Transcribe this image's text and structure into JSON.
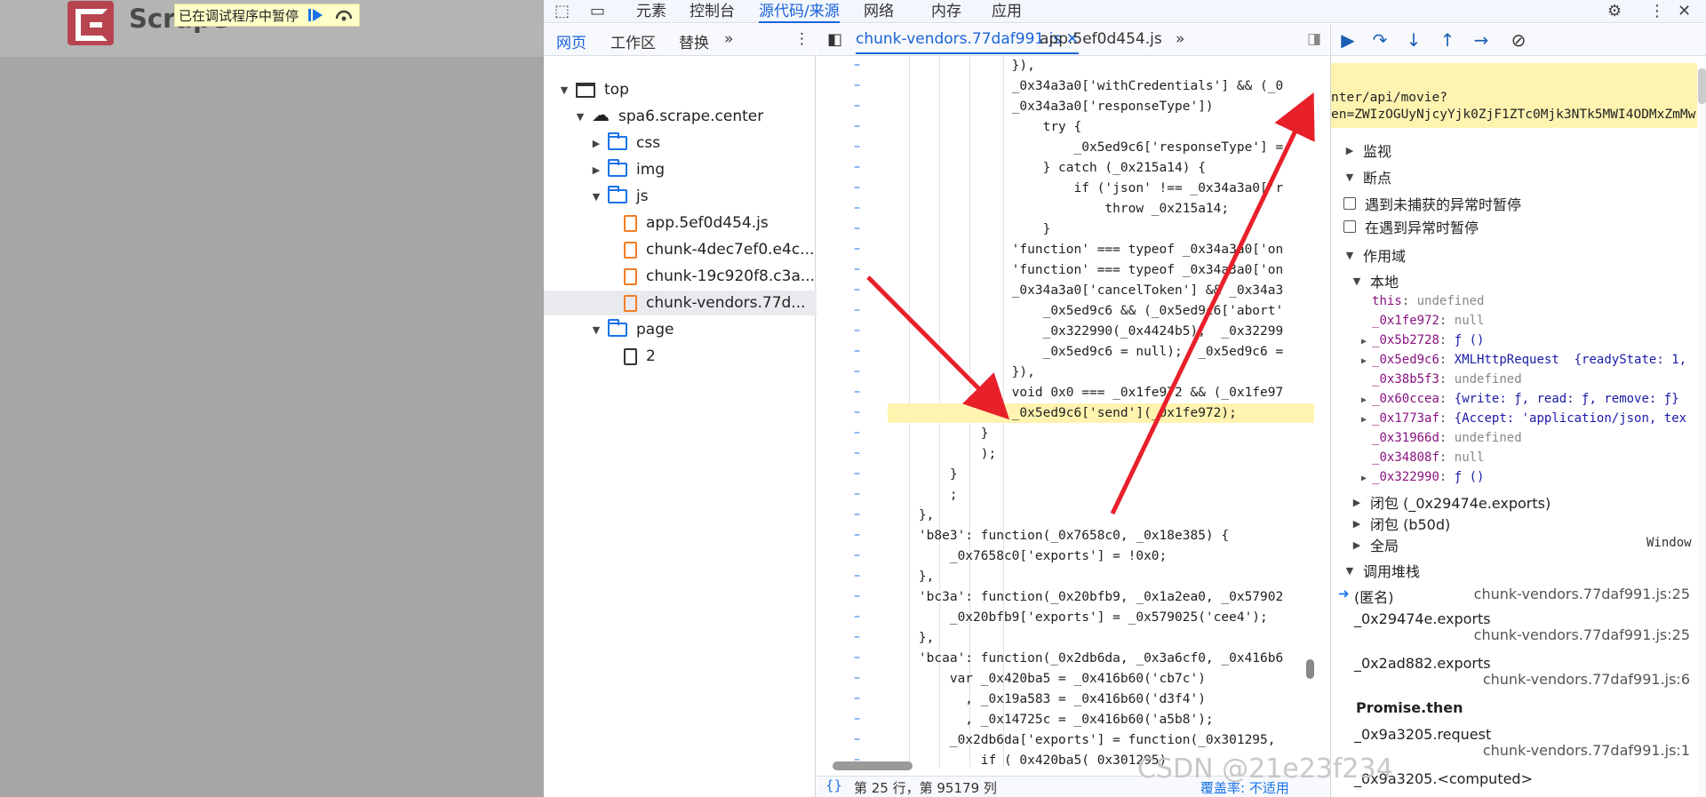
{
  "page": {
    "title": "Scrape",
    "paused_message": "已在调试程序中暂停"
  },
  "devtools": {
    "top_tabs": [
      "元素",
      "控制台",
      "源代码/来源",
      "网络",
      "内存",
      "应用"
    ],
    "active_top_tab": "源代码/来源"
  },
  "navigator": {
    "tabs": [
      "网页",
      "工作区",
      "替换"
    ],
    "tree": {
      "top": "top",
      "domain": "spa6.scrape.center",
      "css": "css",
      "img": "img",
      "js": "js",
      "files": [
        "app.5ef0d454.js",
        "chunk-4dec7ef0.e4c...",
        "chunk-19c920f8.c3a...",
        "chunk-vendors.77d..."
      ],
      "page_folder": "page",
      "page_file": "2"
    }
  },
  "editor": {
    "tabs": [
      "chunk-vendors.77daf991.js",
      "app.5ef0d454.js"
    ],
    "status": {
      "position": "第 25 行，第 95179 列",
      "coverage": "覆盖率: 不适用"
    },
    "lines": [
      "                }),",
      "                _0x34a3a0['withCredentials'] && (_0",
      "                _0x34a3a0['responseType'])",
      "                    try {",
      "                        _0x5ed9c6['responseType'] =",
      "                    } catch (_0x215a14) {",
      "                        if ('json' !== _0x34a3a0['r",
      "                            throw _0x215a14;",
      "                    }",
      "                'function' === typeof _0x34a3a0['on",
      "                'function' === typeof _0x34a3a0['on",
      "                _0x34a3a0['cancelToken'] && _0x34a3",
      "                    _0x5ed9c6 && (_0x5ed9c6['abort'",
      "                    _0x322990(_0x4424b5),  _0x32299",
      "                    _0x5ed9c6 = null);  _0x5ed9c6 =",
      "                }),",
      "                void 0x0 === _0x1fe972 && (_0x1fe97",
      "                _0x5ed9c6['send'](_0x1fe972);",
      "            }",
      "            );",
      "        }",
      "        ;",
      "    },",
      "    'b8e3': function(_0x7658c0, _0x18e385) {",
      "        _0x7658c0['exports'] = !0x0;",
      "    },",
      "    'bc3a': function(_0x20bfb9, _0x1a2ea0, _0x57902",
      "        _0x20bfb9['exports'] = _0x579025('cee4');",
      "    },",
      "    'bcaa': function(_0x2db6da, _0x3a6cf0, _0x416b6",
      "        var _0x420ba5 = _0x416b60('cb7c')",
      "          , _0x19a583 = _0x416b60('d3f4')",
      "          , _0x14725c = _0x416b60('a5b8');",
      "        _0x2db6da['exports'] = function(_0x301295,",
      "            if (_0x420ba5(_0x301295)"
    ]
  },
  "debugger": {
    "pause_lines": [
      "nter/api/movie?",
      "en=ZWIzOGUyNjcyYjk0ZjF1ZTc0Mjk3NTk5MWI4ODMxZmMw"
    ],
    "watch": "监视",
    "breakpoints": "断点",
    "bp_options": [
      "遇到未捕获的异常时暂停",
      "在遇到异常时暂停"
    ],
    "scope": "作用域",
    "local": "本地",
    "vars": [
      {
        "name": "this",
        "value": "undefined"
      },
      {
        "name": "_0x1fe972",
        "value": "null"
      },
      {
        "name": "_0x5b2728",
        "value": "ƒ ()"
      },
      {
        "name": "_0x5ed9c6",
        "value": "XMLHttpRequest  {readyState: 1,"
      },
      {
        "name": "_0x38b5f3",
        "value": "undefined"
      },
      {
        "name": "_0x60ccea",
        "value": "{write: ƒ, read: ƒ, remove: ƒ}"
      },
      {
        "name": "_0x1773af",
        "value": "{Accept: 'application/json, tex"
      },
      {
        "name": "_0x31966d",
        "value": "undefined"
      },
      {
        "name": "_0x34808f",
        "value": "null"
      },
      {
        "name": "_0x322990",
        "value": "ƒ ()"
      }
    ],
    "closures": [
      "闭包 (_0x29474e.exports)",
      "闭包 (b50d)"
    ],
    "global": "全局",
    "global_value": "Window",
    "call_stack": "调用堆栈",
    "frames": [
      {
        "fn": "(匿名)",
        "loc": "chunk-vendors.77daf991.js:25"
      },
      {
        "fn": "_0x29474e.exports",
        "loc": "chunk-vendors.77daf991.js:25"
      },
      {
        "fn": "_0x2ad882.exports",
        "loc": "chunk-vendors.77daf991.js:6"
      },
      {
        "fn": "Promise.then",
        "loc": ""
      },
      {
        "fn": "_0x9a3205.request",
        "loc": "chunk-vendors.77daf991.js:1"
      },
      {
        "fn": "_0x9a3205.<computed>",
        "loc": ""
      }
    ]
  },
  "watermark": "CSDN @21e23f234",
  "colors": {
    "accent": "#1a63d9",
    "annotation": "#e8202a",
    "highlight": "#fff3b0"
  }
}
